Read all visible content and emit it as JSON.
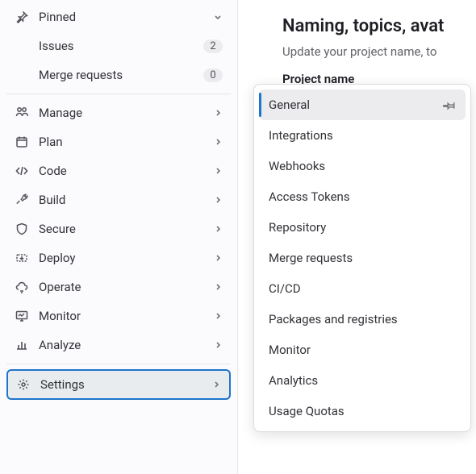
{
  "sidebar": {
    "pinned": {
      "label": "Pinned",
      "items": [
        {
          "label": "Issues",
          "badge": "2"
        },
        {
          "label": "Merge requests",
          "badge": "0"
        }
      ]
    },
    "nav": [
      {
        "icon": "manage",
        "label": "Manage"
      },
      {
        "icon": "plan",
        "label": "Plan"
      },
      {
        "icon": "code",
        "label": "Code"
      },
      {
        "icon": "build",
        "label": "Build"
      },
      {
        "icon": "secure",
        "label": "Secure"
      },
      {
        "icon": "deploy",
        "label": "Deploy"
      },
      {
        "icon": "operate",
        "label": "Operate"
      },
      {
        "icon": "monitor",
        "label": "Monitor"
      },
      {
        "icon": "analyze",
        "label": "Analyze"
      }
    ],
    "settings": {
      "label": "Settings"
    }
  },
  "content": {
    "heading": "Naming, topics, avat",
    "subtext": "Update your project name, to",
    "field_label": "Project name"
  },
  "flyout": {
    "items": [
      {
        "label": "General",
        "selected": true,
        "pinnable": true
      },
      {
        "label": "Integrations"
      },
      {
        "label": "Webhooks"
      },
      {
        "label": "Access Tokens"
      },
      {
        "label": "Repository"
      },
      {
        "label": "Merge requests"
      },
      {
        "label": "CI/CD"
      },
      {
        "label": "Packages and registries"
      },
      {
        "label": "Monitor"
      },
      {
        "label": "Analytics"
      },
      {
        "label": "Usage Quotas"
      }
    ]
  }
}
